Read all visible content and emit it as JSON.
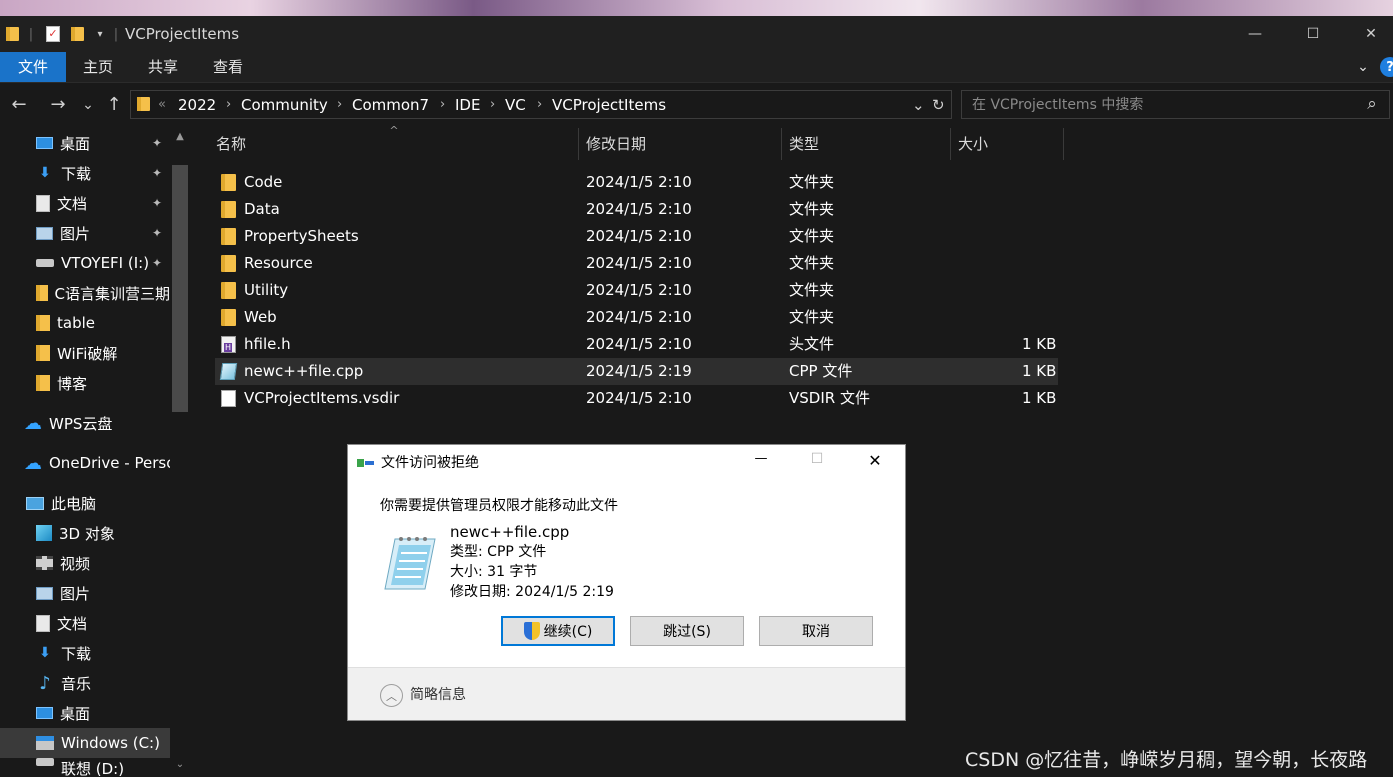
{
  "window": {
    "title": "VCProjectItems",
    "controls": {
      "minimize": "—",
      "maximize": "☐",
      "close": "✕"
    }
  },
  "ribbon": {
    "tabs": [
      "文件",
      "主页",
      "共享",
      "查看"
    ],
    "expand_icon": "chevron-down-icon",
    "help_icon": "help-icon"
  },
  "nav": {
    "back": "←",
    "forward": "→",
    "recent": "⌄",
    "up": "↑"
  },
  "address": {
    "overflow": "«",
    "crumbs": [
      "2022",
      "Community",
      "Common7",
      "IDE",
      "VC",
      "VCProjectItems"
    ],
    "separator": "›",
    "dropdown": "⌄",
    "refresh": "↻"
  },
  "search": {
    "placeholder": "在 VCProjectItems 中搜索",
    "icon": "⌕"
  },
  "sidebar": {
    "quick_access": [
      {
        "label": "桌面",
        "icon": "desktop-icon",
        "pinned": true
      },
      {
        "label": "下载",
        "icon": "download-icon",
        "pinned": true
      },
      {
        "label": "文档",
        "icon": "document-icon",
        "pinned": true
      },
      {
        "label": "图片",
        "icon": "pictures-icon",
        "pinned": true
      },
      {
        "label": "VTOYEFI (I:)",
        "icon": "drive-icon",
        "pinned": true
      },
      {
        "label": "C语言集训营三期",
        "icon": "folder-icon",
        "pinned": false
      },
      {
        "label": "table",
        "icon": "folder-icon",
        "pinned": false
      },
      {
        "label": "WiFi破解",
        "icon": "folder-icon",
        "pinned": false
      },
      {
        "label": "博客",
        "icon": "folder-icon",
        "pinned": false
      }
    ],
    "wps": {
      "label": "WPS云盘",
      "icon": "cloud-icon"
    },
    "onedrive": {
      "label": "OneDrive - Personal",
      "icon": "cloud-icon"
    },
    "this_pc": {
      "label": "此电脑",
      "icon": "computer-icon",
      "items": [
        {
          "label": "3D 对象",
          "icon": "3d-objects-icon"
        },
        {
          "label": "视频",
          "icon": "video-icon"
        },
        {
          "label": "图片",
          "icon": "pictures-icon"
        },
        {
          "label": "文档",
          "icon": "document-icon"
        },
        {
          "label": "下载",
          "icon": "download-icon"
        },
        {
          "label": "音乐",
          "icon": "music-icon"
        },
        {
          "label": "桌面",
          "icon": "desktop-icon"
        },
        {
          "label": "Windows (C:)",
          "icon": "windows-drive-icon",
          "selected": true
        },
        {
          "label": "联想 (D:)",
          "icon": "drive-icon"
        }
      ]
    },
    "pin_glyph": "📌"
  },
  "filelist": {
    "columns": [
      "名称",
      "修改日期",
      "类型",
      "大小"
    ],
    "sort_indicator": "^",
    "rows": [
      {
        "name": "Code",
        "date": "2024/1/5 2:10",
        "type": "文件夹",
        "size": "",
        "icon": "folder"
      },
      {
        "name": "Data",
        "date": "2024/1/5 2:10",
        "type": "文件夹",
        "size": "",
        "icon": "folder"
      },
      {
        "name": "PropertySheets",
        "date": "2024/1/5 2:10",
        "type": "文件夹",
        "size": "",
        "icon": "folder"
      },
      {
        "name": "Resource",
        "date": "2024/1/5 2:10",
        "type": "文件夹",
        "size": "",
        "icon": "folder"
      },
      {
        "name": "Utility",
        "date": "2024/1/5 2:10",
        "type": "文件夹",
        "size": "",
        "icon": "folder"
      },
      {
        "name": "Web",
        "date": "2024/1/5 2:10",
        "type": "文件夹",
        "size": "",
        "icon": "folder"
      },
      {
        "name": "hfile.h",
        "date": "2024/1/5 2:10",
        "type": "头文件",
        "size": "1 KB",
        "icon": "h"
      },
      {
        "name": "newc++file.cpp",
        "date": "2024/1/5 2:19",
        "type": "CPP 文件",
        "size": "1 KB",
        "icon": "cpp",
        "selected": true
      },
      {
        "name": "VCProjectItems.vsdir",
        "date": "2024/1/5 2:10",
        "type": "VSDIR 文件",
        "size": "1 KB",
        "icon": "vsdir"
      }
    ]
  },
  "dialog": {
    "title": "文件访问被拒绝",
    "message": "你需要提供管理员权限才能移动此文件",
    "file_name": "newc++file.cpp",
    "file_type": "类型: CPP 文件",
    "file_size": "大小: 31 字节",
    "file_modified": "修改日期: 2024/1/5 2:19",
    "buttons": {
      "continue": "继续(C)",
      "skip": "跳过(S)",
      "cancel": "取消"
    },
    "details_toggle": "简略信息",
    "controls": {
      "minimize": "—",
      "maximize": "☐",
      "close": "✕"
    }
  },
  "watermark": "CSDN @忆往昔，峥嵘岁月稠，望今朝，长夜路"
}
